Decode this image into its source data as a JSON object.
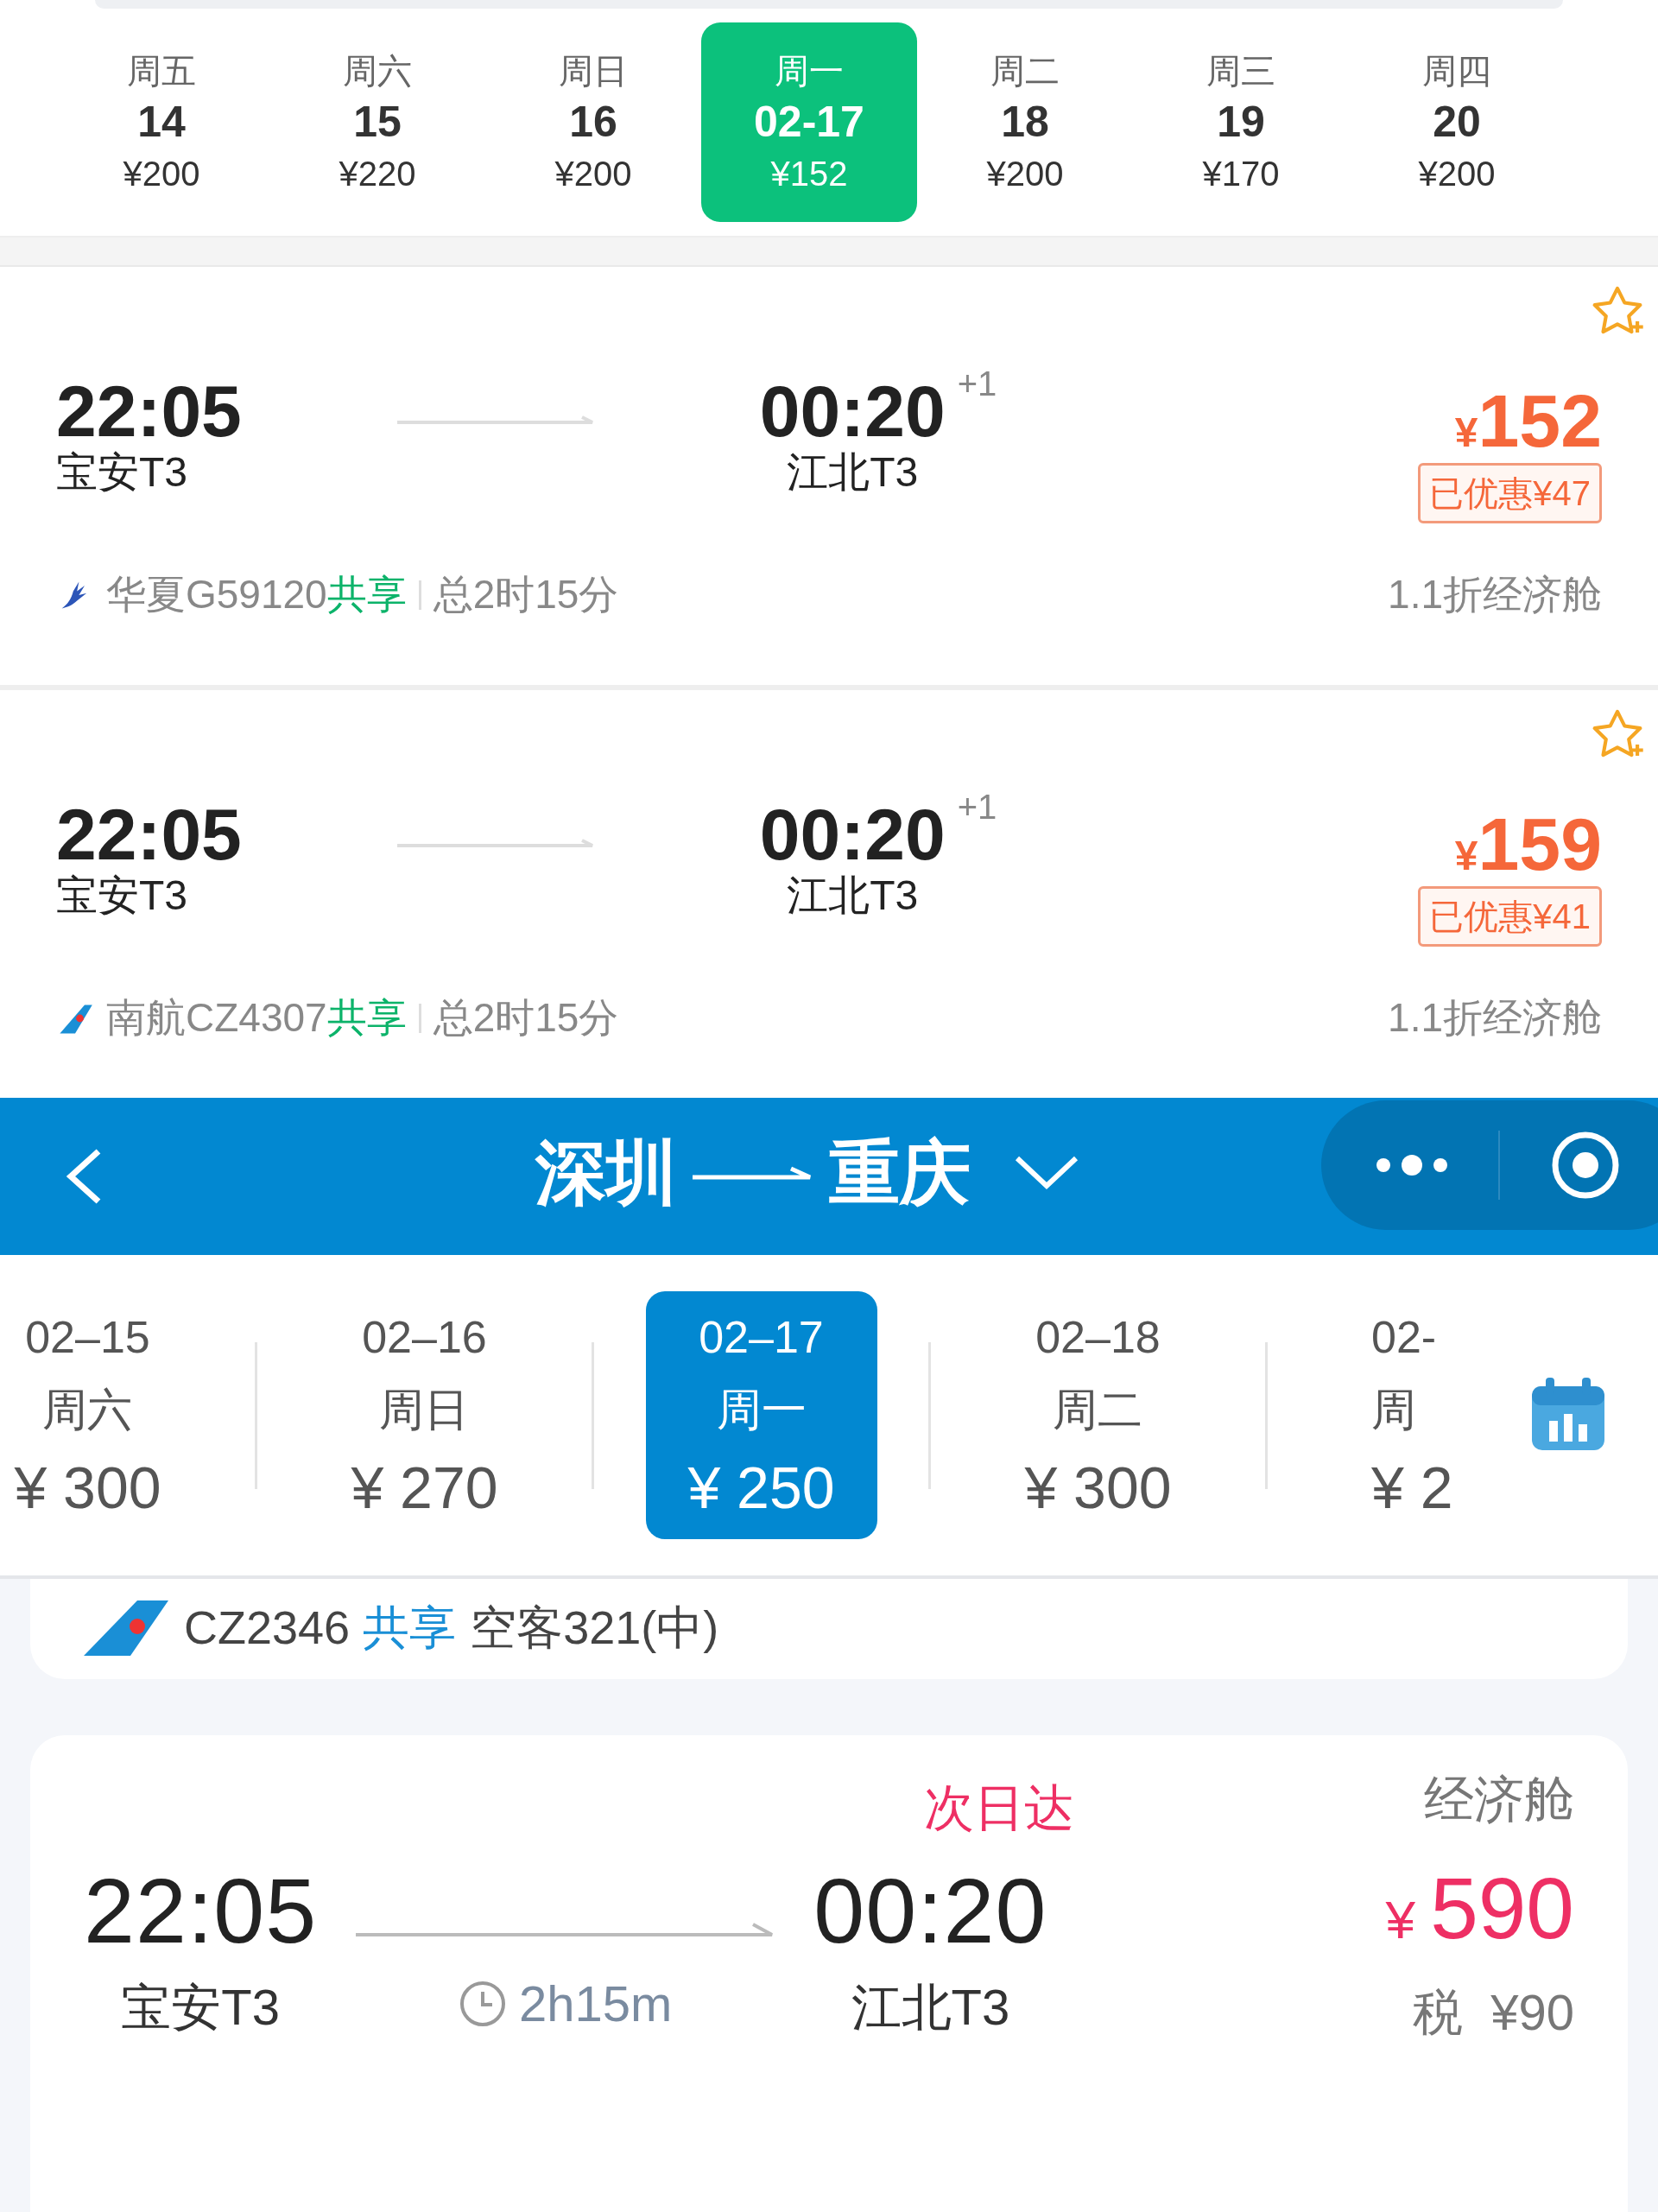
{
  "top_app": {
    "dates": [
      {
        "weekday": "周五",
        "day": "14",
        "price": "¥200",
        "selected": false
      },
      {
        "weekday": "周六",
        "day": "15",
        "price": "¥220",
        "selected": false
      },
      {
        "weekday": "周日",
        "day": "16",
        "price": "¥200",
        "selected": false
      },
      {
        "weekday": "周一",
        "day": "02-17",
        "price": "¥152",
        "selected": true
      },
      {
        "weekday": "周二",
        "day": "18",
        "price": "¥200",
        "selected": false
      },
      {
        "weekday": "周三",
        "day": "19",
        "price": "¥170",
        "selected": false
      },
      {
        "weekday": "周四",
        "day": "20",
        "price": "¥200",
        "selected": false
      }
    ],
    "flights": [
      {
        "dep_time": "22:05",
        "dep_airport": "宝安T3",
        "arr_time": "00:20",
        "day_offset": "+1",
        "arr_airport": "江北T3",
        "price_symbol": "¥",
        "price": "152",
        "discount": "已优惠¥47",
        "airline_flight": "华夏G59120",
        "share_tag": "共享",
        "duration": "总2时15分",
        "cabin": "1.1折经济舱"
      },
      {
        "dep_time": "22:05",
        "dep_airport": "宝安T3",
        "arr_time": "00:20",
        "day_offset": "+1",
        "arr_airport": "江北T3",
        "price_symbol": "¥",
        "price": "159",
        "discount": "已优惠¥41",
        "airline_flight": "南航CZ4307",
        "share_tag": "共享",
        "duration": "总2时15分",
        "cabin": "1.1折经济舱"
      }
    ]
  },
  "bottom_app": {
    "header": {
      "from": "深圳",
      "to": "重庆"
    },
    "dates": [
      {
        "date": "02–15",
        "weekday": "周六",
        "price": "¥ 300",
        "selected": false
      },
      {
        "date": "02–16",
        "weekday": "周日",
        "price": "¥ 270",
        "selected": false
      },
      {
        "date": "02–17",
        "weekday": "周一",
        "price": "¥ 250",
        "selected": true
      },
      {
        "date": "02–18",
        "weekday": "周二",
        "price": "¥ 300",
        "selected": false
      },
      {
        "date": "02-",
        "weekday": "周",
        "price": "¥ 2",
        "selected": false
      }
    ],
    "flight_partial": {
      "flight_no": "CZ2346",
      "share_tag": "共享",
      "aircraft": "空客321(中)"
    },
    "flight": {
      "arrival_note": "次日达",
      "cabin": "经济舱",
      "dep_time": "22:05",
      "dep_airport": "宝安T3",
      "duration": "2h15m",
      "arr_time": "00:20",
      "arr_airport": "江北T3",
      "price_symbol": "¥",
      "price": "590",
      "tax": "税  ¥90"
    }
  }
}
